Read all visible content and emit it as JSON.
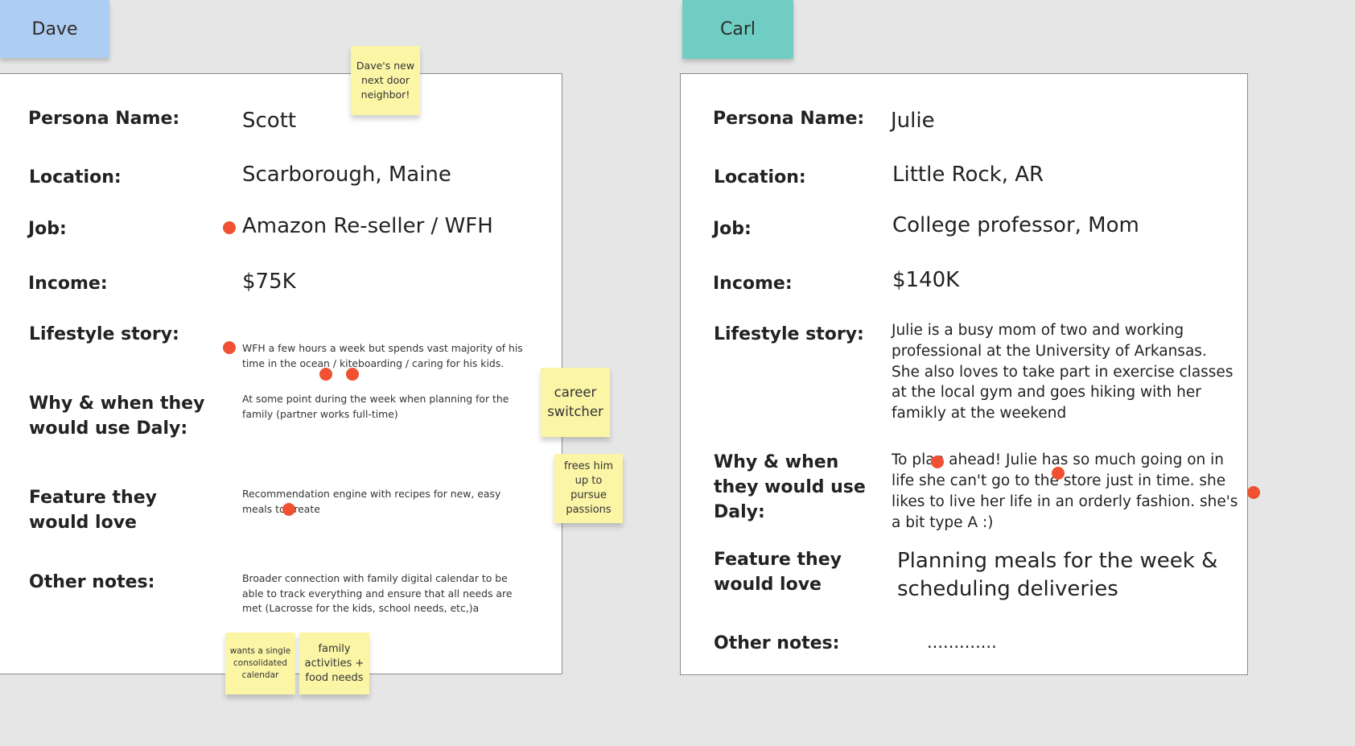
{
  "frames": {
    "left_tag": "Dave",
    "right_tag": "Carl"
  },
  "labels": {
    "persona_name": "Persona Name:",
    "location": "Location:",
    "job": "Job:",
    "income": "Income:",
    "lifestyle_story": "Lifestyle story:",
    "why_when": "Why & when they would use Daly:",
    "feature": "Feature they would love",
    "other_notes": "Other notes:"
  },
  "dave_card": {
    "persona_name": "Scott",
    "location": "Scarborough, Maine",
    "job": "Amazon Re-seller / WFH",
    "income": "$75K",
    "lifestyle_story": "WFH a few hours a week but spends vast majority of his time in the ocean / kiteboarding / caring for his kids.",
    "why_when": "At some point during the week when planning for the family (partner works full-time)",
    "feature": "Recommendation engine with recipes for new, easy meals to create",
    "other_notes": "Broader connection with family digital calendar to be able to track everything and ensure that all needs are met (Lacrosse for the kids, school needs, etc,)a"
  },
  "carl_card": {
    "persona_name": "Julie",
    "location": "Little Rock, AR",
    "job": "College professor, Mom",
    "income": "$140K",
    "lifestyle_story": "Julie is a busy mom of two and working professional at the University of Arkansas. She also loves to take part in exercise classes at the local gym and goes hiking with her famikly at the weekend",
    "why_when": "To plan ahead! Julie has so much going on in life she can't go to the store just in time. she likes to live her life in an orderly fashion. she's a bit type A :)",
    "feature": "Planning meals for the week & scheduling deliveries",
    "other_notes": "............."
  },
  "stickies": {
    "neighbor": "Dave's new next door neighbor!",
    "career": "career switcher",
    "frees": "frees him up to pursue passions",
    "calendar": "wants a single consolidated calendar",
    "family": "family activities + food needs"
  },
  "colors": {
    "dave_tag": "#aecdf2",
    "carl_tag": "#6fcdc3",
    "sticky": "#fbf5a6",
    "vote_dot": "#f05132"
  }
}
